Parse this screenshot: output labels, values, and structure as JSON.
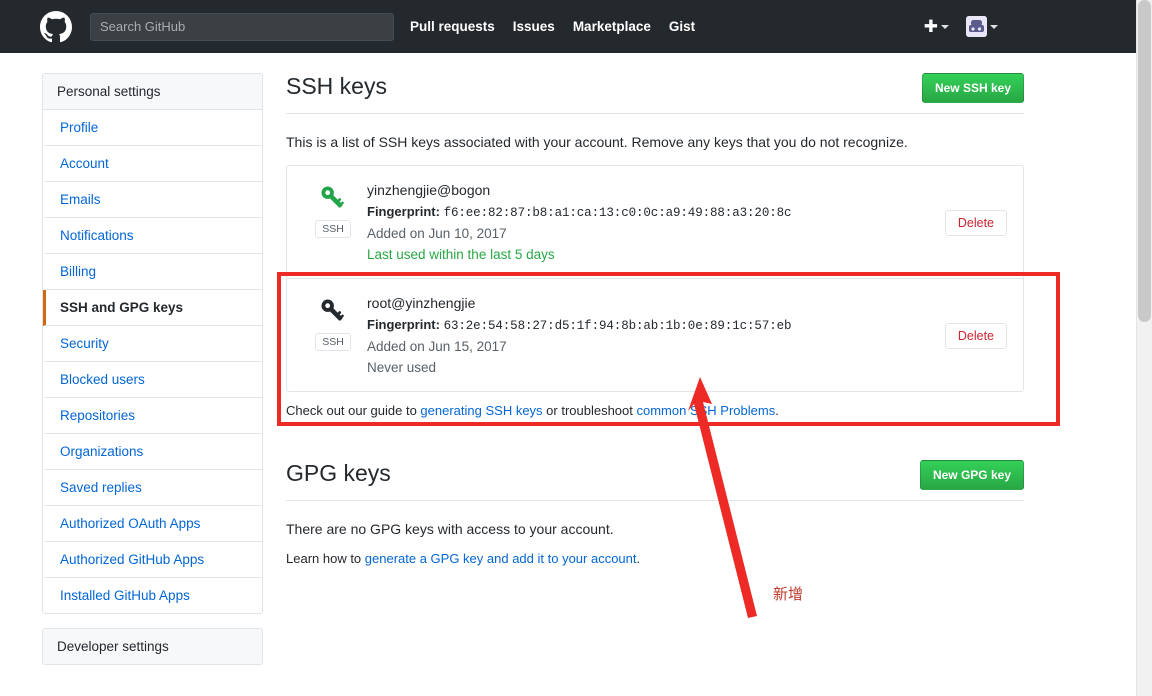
{
  "header": {
    "logo_icon": "github-mark-icon",
    "search": {
      "placeholder": "Search GitHub",
      "value": ""
    },
    "nav": [
      {
        "label": "Pull requests"
      },
      {
        "label": "Issues"
      },
      {
        "label": "Marketplace"
      },
      {
        "label": "Gist"
      }
    ],
    "create_new_icon": "plus-icon",
    "create_new_caret_icon": "chevron-down-icon",
    "avatar_icon": "user-avatar-icon",
    "avatar_caret_icon": "chevron-down-icon"
  },
  "sidebar": {
    "heading": "Personal settings",
    "items": [
      {
        "label": "Profile",
        "selected": false
      },
      {
        "label": "Account",
        "selected": false
      },
      {
        "label": "Emails",
        "selected": false
      },
      {
        "label": "Notifications",
        "selected": false
      },
      {
        "label": "Billing",
        "selected": false
      },
      {
        "label": "SSH and GPG keys",
        "selected": true
      },
      {
        "label": "Security",
        "selected": false
      },
      {
        "label": "Blocked users",
        "selected": false
      },
      {
        "label": "Repositories",
        "selected": false
      },
      {
        "label": "Organizations",
        "selected": false
      },
      {
        "label": "Saved replies",
        "selected": false
      },
      {
        "label": "Authorized OAuth Apps",
        "selected": false
      },
      {
        "label": "Authorized GitHub Apps",
        "selected": false
      },
      {
        "label": "Installed GitHub Apps",
        "selected": false
      }
    ],
    "developer_heading": "Developer settings"
  },
  "ssh": {
    "title": "SSH keys",
    "new_key_button": "New SSH key",
    "description": "This is a list of SSH keys associated with your account. Remove any keys that you do not recognize.",
    "keys": [
      {
        "name": "yinzhengjie@bogon",
        "fingerprint_label": "Fingerprint:",
        "fingerprint": "f6:ee:82:87:b8:a1:ca:13:c0:0c:a9:49:88:a3:20:8c",
        "added": "Added on Jun 10, 2017",
        "usage": "Last used within the last 5 days",
        "usage_state": "used",
        "badge": "SSH",
        "key_icon": "key-icon-green",
        "delete_label": "Delete"
      },
      {
        "name": "root@yinzhengjie",
        "fingerprint_label": "Fingerprint:",
        "fingerprint": "63:2e:54:58:27:d5:1f:94:8b:ab:1b:0e:89:1c:57:eb",
        "added": "Added on Jun 15, 2017",
        "usage": "Never used",
        "usage_state": "never",
        "badge": "SSH",
        "key_icon": "key-icon-dark",
        "delete_label": "Delete"
      }
    ],
    "guide_prefix": "Check out our guide to ",
    "guide_link_1": "generating SSH keys",
    "guide_middle": " or troubleshoot ",
    "guide_link_2": "common SSH Problems",
    "guide_suffix": "."
  },
  "gpg": {
    "title": "GPG keys",
    "new_key_button": "New GPG key",
    "empty_text": "There are no GPG keys with access to your account.",
    "learn_prefix": "Learn how to ",
    "learn_link": "generate a GPG key and add it to your account",
    "learn_suffix": "."
  },
  "annotations": {
    "highlight_box_color": "#ed2a25",
    "arrow_color": "#ed2a25",
    "label": "新增"
  }
}
